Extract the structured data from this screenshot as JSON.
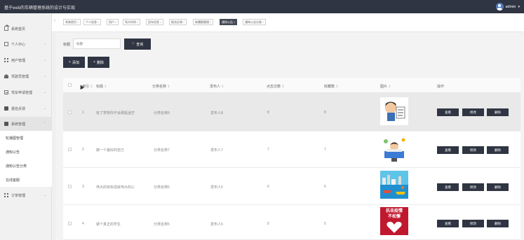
{
  "app_title": "基于web的车辆管理系统的设计与实现",
  "user": {
    "name": "admin",
    "caret": "▾"
  },
  "sidebar": {
    "items": [
      {
        "label": "系统首页",
        "icon": "home-icon"
      },
      {
        "label": "个人中心",
        "icon": "box-icon"
      },
      {
        "label": "用户管理",
        "icon": "grid-icon"
      },
      {
        "label": "驾驶员管理",
        "icon": "bank-icon"
      },
      {
        "label": "驾车申请管理",
        "icon": "doc-icon"
      },
      {
        "label": "报名反馈",
        "icon": "book-icon"
      },
      {
        "label": "系统管理",
        "icon": "book-icon"
      },
      {
        "label": "订单管理",
        "icon": "grid-icon"
      }
    ],
    "sub_items": [
      "轮播图管理",
      "通知公告",
      "通知公告分类",
      "在线客服"
    ],
    "arrow": "⌄"
  },
  "tabs": [
    {
      "label": "系统首页",
      "active": false
    },
    {
      "label": "个人信息",
      "active": false
    },
    {
      "label": "用户",
      "active": false
    },
    {
      "label": "驾大时间",
      "active": false
    },
    {
      "label": "回车信息",
      "active": false
    },
    {
      "label": "报名反馈",
      "active": false
    },
    {
      "label": "轮播图管理",
      "active": false
    },
    {
      "label": "通知公告",
      "active": true
    },
    {
      "label": "通知公告分类",
      "active": false
    }
  ],
  "tab_close": "×",
  "search": {
    "label": "标题",
    "placeholder": "标题",
    "query_button": "查询",
    "query_icon": "♡"
  },
  "actions": {
    "add_label": "添加",
    "add_icon": "+",
    "delete_label": "删除",
    "delete_icon": "×"
  },
  "table": {
    "headers": {
      "index": "索引",
      "title": "标题",
      "category": "分类名称",
      "publisher": "发布人",
      "clicks": "点击次数",
      "favorites": "收藏数",
      "image": "图片",
      "operation": "操作"
    },
    "sort_glyph": "⇕",
    "rows": [
      {
        "index": "1",
        "title": "有了梦想你不会那般迷茫",
        "category": "分类名称8",
        "publisher": "发布人8",
        "clicks": "8",
        "favorites": "8",
        "image": "thumb-cartoon-boy-sign",
        "highlighted": true
      },
      {
        "index": "2",
        "title": "做一个最好的自己",
        "category": "分类名称7",
        "publisher": "发布人7",
        "clicks": "7",
        "favorites": "7",
        "image": "thumb-cartoon-office",
        "highlighted": false
      },
      {
        "index": "3",
        "title": "伟大的目标造就伟大的心",
        "category": "分类名称6",
        "publisher": "发布人6",
        "clicks": "6",
        "favorites": "6",
        "image": "thumb-harbor-scene",
        "highlighted": false
      },
      {
        "index": "4",
        "title": "做个真正的学生",
        "category": "分类名称5",
        "publisher": "发布人5",
        "clicks": "5",
        "favorites": "5",
        "image": "thumb-epidemic-poster",
        "highlighted": false
      }
    ],
    "op_buttons": {
      "view": "查看",
      "edit": "修改",
      "delete": "删除"
    },
    "poster_text": [
      "抗击疫情",
      "不松懈"
    ]
  },
  "colors": {
    "topbar": "#2f3542",
    "button": "#2f3542",
    "active_tab": "#444b57"
  }
}
